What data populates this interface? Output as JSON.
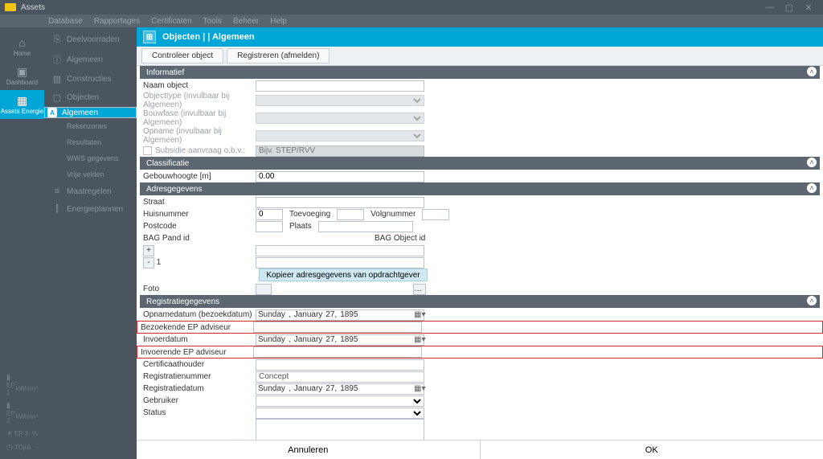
{
  "title": "Assets",
  "menubar": [
    "Database",
    "Rapportages",
    "Certificaten",
    "Tools",
    "Beheer",
    "Help"
  ],
  "rail": {
    "items": [
      {
        "icon": "⌂",
        "label": "Home"
      },
      {
        "icon": "▣",
        "label": "Dashboard"
      },
      {
        "icon": "▦",
        "label": "Assets Energie",
        "active": true
      }
    ],
    "metrics": [
      {
        "icon": "▮",
        "name": "EP 1",
        "val": "- kWh/m²"
      },
      {
        "icon": "▮",
        "name": "EP 2",
        "val": "- kWh/m²"
      },
      {
        "icon": "✶",
        "name": "EP 3",
        "val": "- %"
      },
      {
        "icon": "◷",
        "name": "TOjuli",
        "val": "-"
      }
    ]
  },
  "nav": [
    {
      "icon": "⎘",
      "label": "Deelvoorraden"
    },
    {
      "icon": "ⓘ",
      "label": "Algemeen"
    },
    {
      "icon": "▥",
      "label": "Constructies"
    },
    {
      "icon": "▢",
      "label": "Objecten"
    },
    {
      "badge": "A",
      "label": "Algemeen",
      "selected": true
    },
    {
      "sub": true,
      "label": "Rekenzones"
    },
    {
      "sub": true,
      "label": "Resultaten"
    },
    {
      "sub": true,
      "label": "WWS gegevens"
    },
    {
      "sub": true,
      "label": "Vrije velden"
    },
    {
      "icon": "≡",
      "label": "Maatregelen"
    },
    {
      "icon": "⫿",
      "label": "Energieplannen"
    }
  ],
  "crumb": "Objecten |  | Algemeen",
  "tabs": [
    "Controleer object",
    "Registreren (afmelden)"
  ],
  "informatief": {
    "h": "Informatief",
    "naam": "Naam object",
    "objtype": "Objecttype (invulbaar bij Algemeen)",
    "bouwfase": "Bouwfase (invulbaar bij Algemeen)",
    "opname": "Opname (invulbaar bij Algemeen)",
    "subsidie": "Subsidie aanvraag o.b.v.:",
    "subsidie_ph": "Bijv. STEP/RVV"
  },
  "classificatie": {
    "h": "Classificatie",
    "gebouwh": "Gebouwhoogte [m]",
    "gebouwh_v": "0.00"
  },
  "adres": {
    "h": "Adresgegevens",
    "straat": "Straat",
    "huisnr": "Huisnummer",
    "huisnr_v": "0",
    "toev": "Toevoeging",
    "volg": "Volgnummer",
    "post": "Postcode",
    "plaats": "Plaats",
    "bagp": "BAG Pand id",
    "bago": "BAG Object id",
    "one": "1",
    "kopie": "Kopieer adresgegevens van opdrachtgever",
    "foto": "Foto"
  },
  "reg": {
    "h": "Registratiegegevens",
    "opdat": "Opnamedatum (bezoekdatum)",
    "bez": "Bezoekende EP adviseur",
    "invd": "Invoerdatum",
    "inva": "Invoerende  EP adviseur",
    "cert": "Certificaathouder",
    "regnr": "Registratienummer",
    "regnr_v": "Concept",
    "regdat": "Registratiedatum",
    "gebr": "Gebruiker",
    "status": "Status",
    "d_day": "Sunday",
    "d_mon": "January",
    "d_num": "27,",
    "d_yr": "1895"
  },
  "footer": {
    "cancel": "Annuleren",
    "ok": "OK"
  }
}
